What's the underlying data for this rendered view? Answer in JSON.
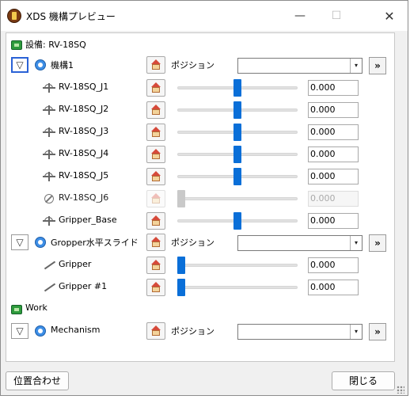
{
  "window": {
    "title": "XDS 機構プレビュー",
    "minimize": "—",
    "maximize": "☐",
    "close": "✕"
  },
  "equipment": {
    "label": "設備: RV-18SQ"
  },
  "mechanisms": [
    {
      "name": "機構1",
      "position_label": "ポジション",
      "position_value": ""
    },
    {
      "name": "Gropper水平スライド",
      "position_label": "ポジション",
      "position_value": ""
    },
    {
      "name": "Mechanism",
      "position_label": "ポジション",
      "position_value": ""
    }
  ],
  "joints": [
    {
      "name": "RV-18SQ_J1",
      "value": "0.000",
      "slider": 0.5,
      "enabled": true
    },
    {
      "name": "RV-18SQ_J2",
      "value": "0.000",
      "slider": 0.5,
      "enabled": true
    },
    {
      "name": "RV-18SQ_J3",
      "value": "0.000",
      "slider": 0.5,
      "enabled": true
    },
    {
      "name": "RV-18SQ_J4",
      "value": "0.000",
      "slider": 0.5,
      "enabled": true
    },
    {
      "name": "RV-18SQ_J5",
      "value": "0.000",
      "slider": 0.5,
      "enabled": true
    },
    {
      "name": "RV-18SQ_J6",
      "value": "0.000",
      "slider": 0.0,
      "enabled": false
    },
    {
      "name": "Gripper_Base",
      "value": "0.000",
      "slider": 0.5,
      "enabled": true
    },
    {
      "name": "Gripper",
      "value": "0.000",
      "slider": 0.0,
      "enabled": true
    },
    {
      "name": "Gripper #1",
      "value": "0.000",
      "slider": 0.0,
      "enabled": true
    }
  ],
  "work": {
    "label": "Work"
  },
  "icons": {
    "expand": "▽",
    "dropdown": "▾",
    "double_down": "»"
  },
  "footer": {
    "align_button": "位置合わせ",
    "close_button": "閉じる"
  },
  "colors": {
    "accent": "#0a6fd8",
    "focus": "#2a62d6"
  }
}
